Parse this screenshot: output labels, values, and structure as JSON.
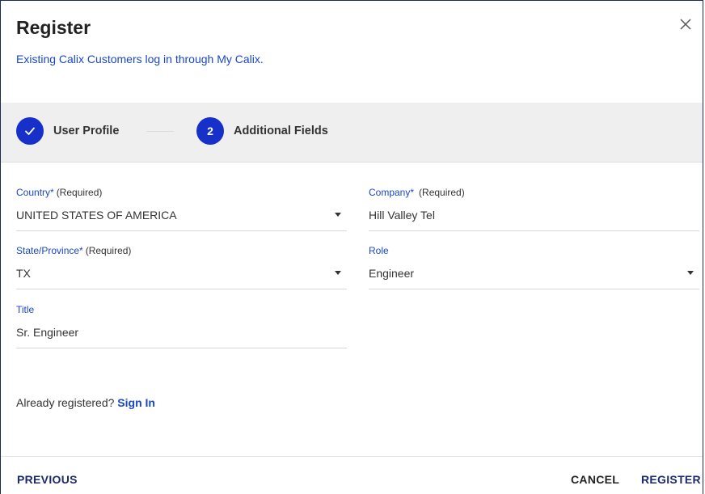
{
  "dialog": {
    "title": "Register",
    "subtitle": "Existing Calix Customers log in through My Calix."
  },
  "stepper": {
    "steps": [
      {
        "marker": "",
        "label": "User Profile",
        "state": "completed"
      },
      {
        "marker": "2",
        "label": "Additional Fields",
        "state": "active"
      }
    ]
  },
  "form": {
    "country": {
      "label": "Country*",
      "required": "(Required)",
      "value": "UNITED STATES OF AMERICA"
    },
    "company": {
      "label": "Company*",
      "required": "(Required)",
      "value": "Hill Valley Tel"
    },
    "state": {
      "label": "State/Province*",
      "required": "(Required)",
      "value": "TX"
    },
    "role": {
      "label": "Role",
      "value": "Engineer"
    },
    "title": {
      "label": "Title",
      "value": "Sr. Engineer"
    }
  },
  "signin": {
    "prompt": "Already registered?",
    "link": "Sign In"
  },
  "footer": {
    "previous": "PREVIOUS",
    "cancel": "CANCEL",
    "register": "REGISTER"
  },
  "colors": {
    "accent": "#1730c9",
    "link": "#1a47c9",
    "button_text": "#1a2a6c",
    "stepper_bg": "#efefef"
  },
  "icons": {
    "close": "close-icon",
    "check": "check-icon",
    "dropdown": "chevron-down-icon"
  }
}
